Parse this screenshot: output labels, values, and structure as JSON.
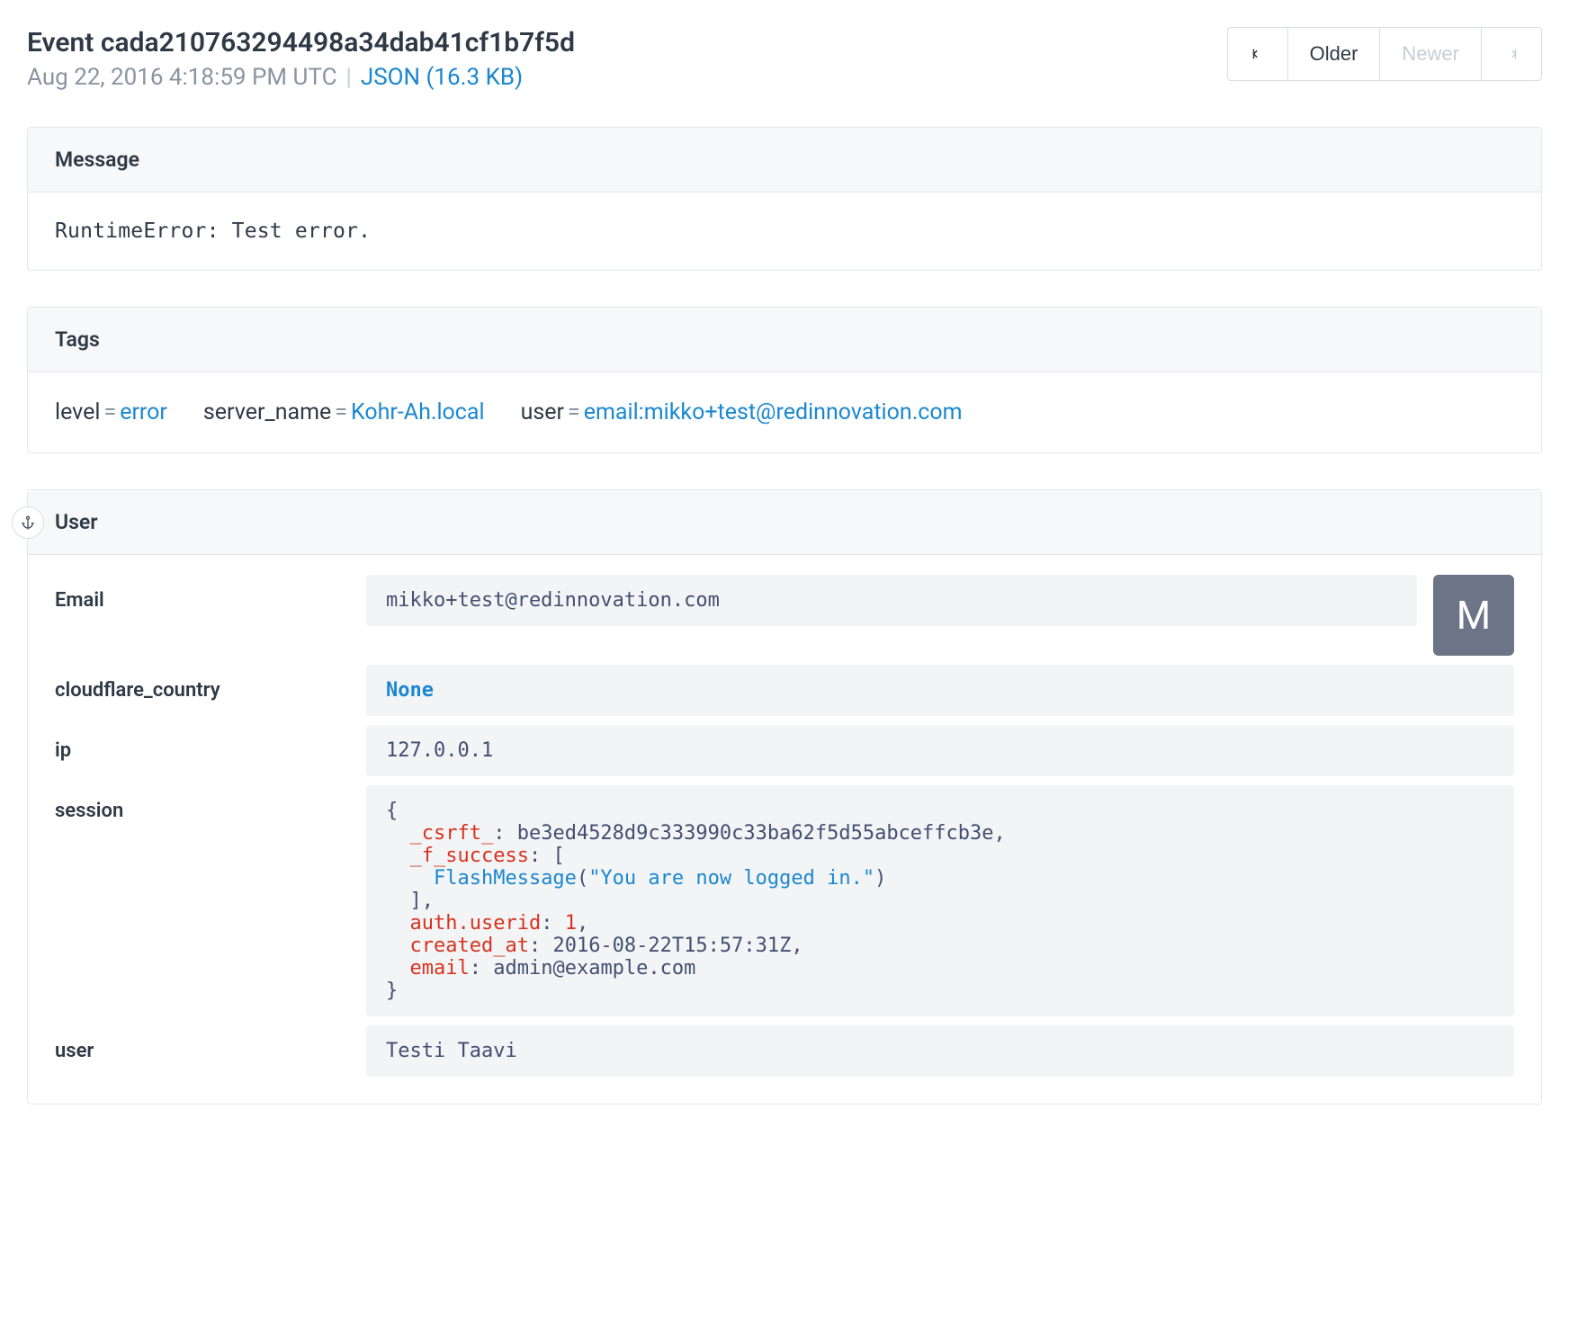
{
  "header": {
    "event_label": "Event",
    "event_id": "cada210763294498a34dab41cf1b7f5d",
    "timestamp": "Aug 22, 2016 4:18:59 PM UTC",
    "json_link": "JSON (16.3 KB)"
  },
  "nav": {
    "older": "Older",
    "newer": "Newer"
  },
  "sections": {
    "message_title": "Message",
    "message_body": "RuntimeError: Test error.",
    "tags_title": "Tags",
    "user_title": "User"
  },
  "tags": [
    {
      "key": "level",
      "value": "error"
    },
    {
      "key": "server_name",
      "value": "Kohr-Ah.local"
    },
    {
      "key": "user",
      "value": "email:mikko+test@redinnovation.com"
    }
  ],
  "user": {
    "avatar_letter": "M",
    "rows": {
      "email_label": "Email",
      "email_value": "mikko+test@redinnovation.com",
      "cloudflare_label": "cloudflare_country",
      "cloudflare_value": "None",
      "ip_label": "ip",
      "ip_value": "127.0.0.1",
      "session_label": "session",
      "user_label": "user",
      "user_value": "Testi Taavi"
    },
    "session": {
      "_csrft_": "be3ed4528d9c333990c33ba62f5d55abceffcb3e",
      "_f_success_call": "FlashMessage",
      "_f_success_arg": "\"You are now logged in.\"",
      "auth_userid": "1",
      "created_at": "2016-08-22T15:57:31Z",
      "email": "admin@example.com"
    }
  }
}
